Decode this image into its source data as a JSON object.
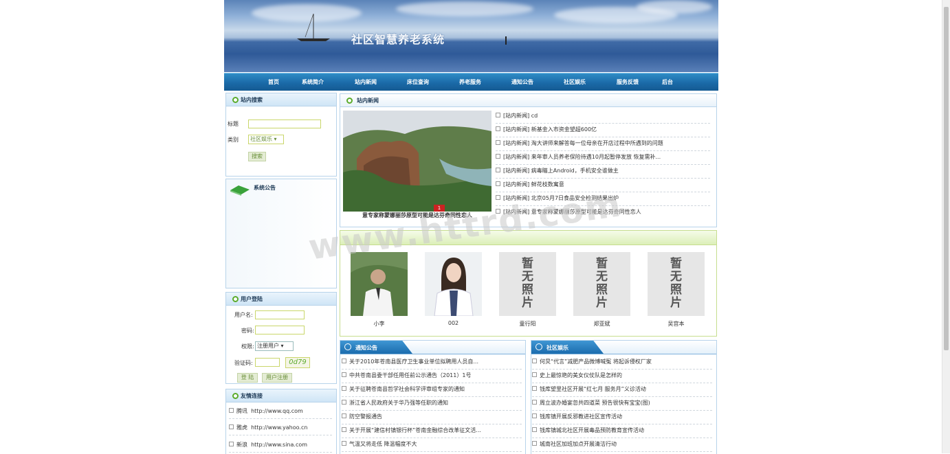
{
  "site": {
    "title": "社区智慧养老系统"
  },
  "nav": {
    "items": [
      "首页",
      "系统简介",
      "站内新闻",
      "床位查询",
      "养老服务",
      "通知公告",
      "社区娱乐",
      "服务反馈",
      "后台"
    ]
  },
  "search": {
    "title": "站内搜索",
    "title_label": "标题",
    "category_label": "类别",
    "category_value": "社区娱乐",
    "button": "搜索"
  },
  "announcement": {
    "title": "系统公告"
  },
  "login": {
    "title": "用户登陆",
    "username_label": "用户名:",
    "password_label": "密码:",
    "role_label": "权限:",
    "role_value": "注册用户",
    "captcha_label": "验证码:",
    "captcha_text": "0d79",
    "login_button": "登 陆",
    "register_button": "用户注册"
  },
  "links": {
    "title": "友情连接",
    "items": [
      {
        "name": "腾讯",
        "url": "http://www.qq.com"
      },
      {
        "name": "雅虎",
        "url": "http://www.yahoo.cn"
      },
      {
        "name": "新浪",
        "url": "http://www.sina.com"
      }
    ]
  },
  "news": {
    "title": "站内新闻",
    "caption": "意专家称蒙娜丽莎原型可能是达芬奇同性恋人",
    "slide_index": "1",
    "items": [
      "[站内新闻] cd",
      "[站内新闻] 新基金入市资金望超600亿",
      "[站内新闻] 淘大讲师来解答每一位母亲在开店过程中所遇到的问题",
      "[站内新闻] 来年审人员养老保险待遇10月起暂停发放 恢复需补...",
      "[站内新闻] 病毒瞄上Android，手机安全谁做主",
      "[站内新闻] 鲜花枝数寓意",
      "[站内新闻] 北京05月7日食品安全检测结果出炉",
      "[站内新闻] 意专家称蒙娜丽莎原型可能是达芬奇同性恋人"
    ]
  },
  "staff": {
    "no_photo": [
      "暂",
      "无",
      "照",
      "片"
    ],
    "people": [
      "小李",
      "002",
      "童行阳",
      "郑亚斌",
      "吴宫本"
    ]
  },
  "notices": {
    "title": "通知公告",
    "items": [
      "关于2010年苍南县医疗卫生事业单位拟聘用人员自...",
      "中共苍南县委干部任用任前公示通告（2011）1号",
      "关于征聘苍南县哲学社会科学评审组专家的通知",
      "浙江省人民政府关于华乃强等任职的通知",
      "防空警报通告",
      "关于开展“建信村镇银行杯”苍南金融综合改革征文活...",
      "气温又将走低 降温幅度不大"
    ]
  },
  "entertainment": {
    "title": "社区娱乐",
    "items": [
      "何炅“代言”减肥产品微博喊冤 将起诉侵权厂家",
      "史上最惊艳的美女仪仗队是怎样的",
      "钱库望里社区开展“红七月 服务月”义诊活动",
      "周立波办婚宴忽共四道菜 预告很快有宝宝(图)",
      "钱库镇开展反邪教进社区宣传活动",
      "钱库镇城北社区开展毒品预防教育宣传活动",
      "城南社区加班加点开展清洁行动"
    ]
  },
  "watermark": "www.httrd.com",
  "colors": {
    "nav": "#1b6aa8",
    "accent_green": "#5aab2b",
    "panel_border": "#b7d3ea"
  }
}
